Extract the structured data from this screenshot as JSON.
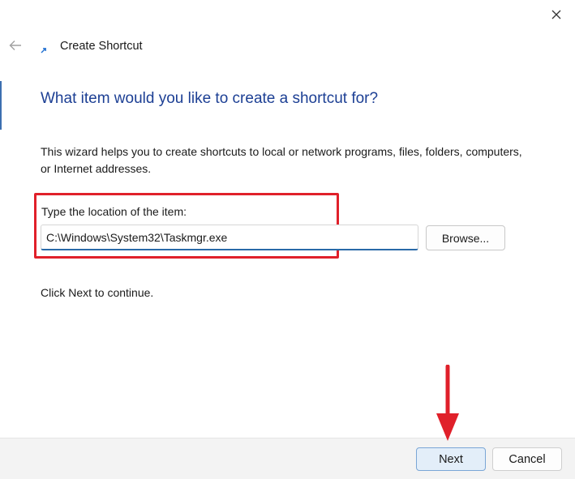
{
  "window": {
    "title": "Create Shortcut",
    "close_icon": "close-icon",
    "back_icon": "back-arrow-icon"
  },
  "page": {
    "heading": "What item would you like to create a shortcut for?",
    "description": "This wizard helps you to create shortcuts to local or network programs, files, folders, computers, or Internet addresses.",
    "location_label": "Type the location of the item:",
    "location_value": "C:\\Windows\\System32\\Taskmgr.exe",
    "browse_label": "Browse...",
    "continue_text": "Click Next to continue."
  },
  "footer": {
    "next_label": "Next",
    "cancel_label": "Cancel"
  },
  "annotations": {
    "highlight_color": "#e0202a",
    "arrow_color": "#e0202a"
  },
  "colors": {
    "heading": "#1c3f94",
    "input_underline": "#2a6aa8",
    "next_button_bg": "#e3eef9",
    "next_button_border": "#7aa6d6"
  }
}
